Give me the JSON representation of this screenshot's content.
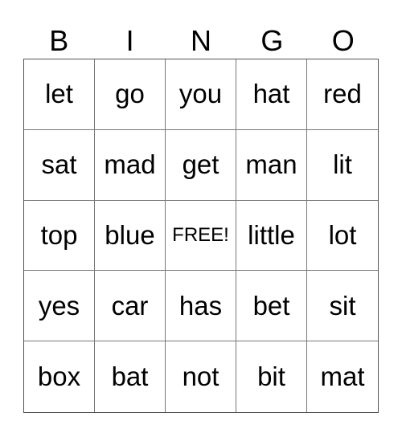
{
  "header": [
    "B",
    "I",
    "N",
    "G",
    "O"
  ],
  "cells": [
    [
      "let",
      "go",
      "you",
      "hat",
      "red"
    ],
    [
      "sat",
      "mad",
      "get",
      "man",
      "lit"
    ],
    [
      "top",
      "blue",
      "FREE!",
      "little",
      "lot"
    ],
    [
      "yes",
      "car",
      "has",
      "bet",
      "sit"
    ],
    [
      "box",
      "bat",
      "not",
      "bit",
      "mat"
    ]
  ]
}
